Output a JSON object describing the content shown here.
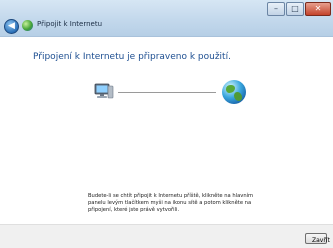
{
  "window": {
    "title": "Připojit k Internetu",
    "controls": {
      "minimize": "–",
      "maximize": "□",
      "close": "✕"
    }
  },
  "nav": {
    "back_symbol": "◀"
  },
  "main": {
    "heading": "Připojení k Internetu je připraveno k použití.",
    "info_text": "Budete-li se chtít připojit k Internetu příště, klikněte na hlavním panelu levým tlačítkem myši na ikonu sítě a potom klikněte na připojení, které jste právě vytvořili."
  },
  "icons": {
    "computer": "computer-icon",
    "globe": "globe-icon",
    "app": "network-globe-icon"
  },
  "footer": {
    "close_label": "Zavřít"
  },
  "colors": {
    "heading": "#1e4f91",
    "titlebar": "#c3d8ec",
    "footer": "#f0f0f0"
  }
}
